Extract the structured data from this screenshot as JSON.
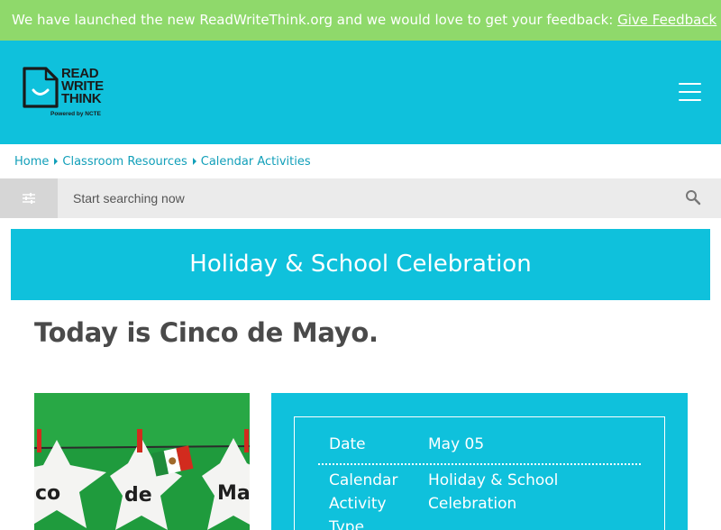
{
  "banner": {
    "message": "We have launched the new ReadWriteThink.org and we would love to get your feedback:",
    "link": "Give Feedback"
  },
  "logo": {
    "line1": "READ",
    "line2": "WRITE",
    "line3": "THINK",
    "powered": "Powered by NCTE"
  },
  "breadcrumb": [
    "Home",
    "Classroom Resources",
    "Calendar Activities"
  ],
  "search": {
    "placeholder": "Start searching now"
  },
  "category_banner": "Holiday & School Celebration",
  "page_title": "Today is Cinco de Mayo.",
  "photo": {
    "text_left": "co",
    "text_mid": "de",
    "text_right": "Ma"
  },
  "info": {
    "date_label": "Date",
    "date_value": "May 05",
    "type_label_1": "Calendar",
    "type_label_2": "Activity",
    "type_label_3": "Type",
    "type_value_1": "Holiday & School",
    "type_value_2": "Celebration"
  },
  "colors": {
    "banner": "#8fd96b",
    "brand_cyan": "#0fc1dc",
    "breadcrumb_link": "#119fb9",
    "title_text": "#4a4a4a"
  }
}
